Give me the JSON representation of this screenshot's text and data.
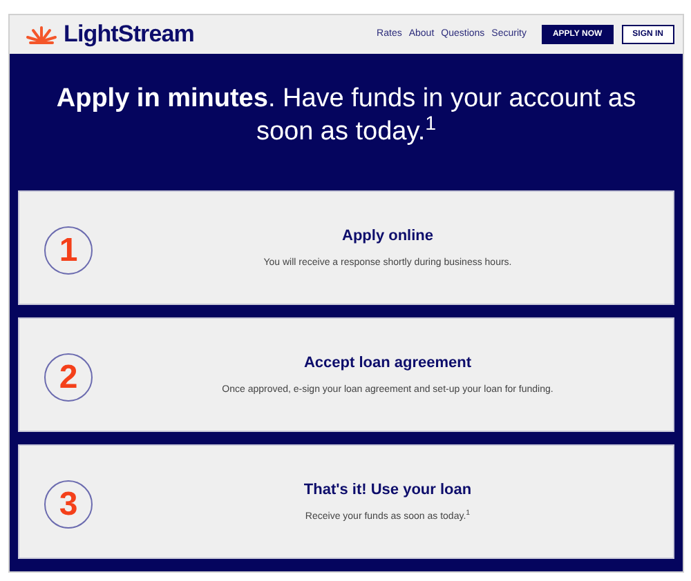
{
  "header": {
    "logo": "LightStream",
    "nav": [
      "Rates",
      "About",
      "Questions",
      "Security"
    ],
    "buttons": [
      {
        "label": "APPLY NOW",
        "kind": "primary"
      },
      {
        "label": "SIGN IN",
        "kind": "outline"
      }
    ]
  },
  "hero": {
    "headline": "**Apply in minutes**. Have funds in your account as soon as today.$^{1}$"
  },
  "steps": [
    {
      "number": "1",
      "title": "Apply online",
      "text": "You will receive a response shortly during business hours."
    },
    {
      "number": "2",
      "title": "Accept loan agreement",
      "text": "Once approved, e-sign your loan agreement and set-up your loan for funding."
    },
    {
      "number": "3",
      "title": "That's it! Use your loan",
      "text": "Receive your funds as soon as today.$^{1}$"
    }
  ]
}
